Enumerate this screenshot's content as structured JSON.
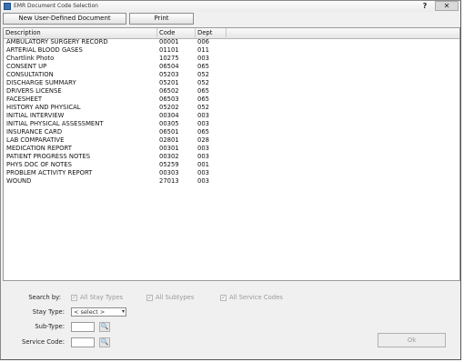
{
  "window": {
    "title": "EMR Document Code Selection",
    "help_glyph": "?",
    "close_glyph": "✕"
  },
  "toolbar": {
    "new_doc_label": "New User-Defined Document",
    "print_label": "Print"
  },
  "table": {
    "columns": [
      "Description",
      "Code",
      "Dept"
    ],
    "rows": [
      [
        "AMBULATORY SURGERY RECORD",
        "00001",
        "006"
      ],
      [
        "ARTERIAL BLOOD GASES",
        "01101",
        "011"
      ],
      [
        "Chartlink Photo",
        "10275",
        "003"
      ],
      [
        "CONSENT UP",
        "06504",
        "065"
      ],
      [
        "CONSULTATION",
        "05203",
        "052"
      ],
      [
        "DISCHARGE SUMMARY",
        "05201",
        "052"
      ],
      [
        "DRIVERS LICENSE",
        "06502",
        "065"
      ],
      [
        "FACESHEET",
        "06503",
        "065"
      ],
      [
        "HISTORY AND PHYSICAL",
        "05202",
        "052"
      ],
      [
        "INITIAL INTERVIEW",
        "00304",
        "003"
      ],
      [
        "INITIAL PHYSICAL ASSESSMENT",
        "00305",
        "003"
      ],
      [
        "INSURANCE CARD",
        "06501",
        "065"
      ],
      [
        "LAB COMPARATIVE",
        "02801",
        "028"
      ],
      [
        "MEDICATION REPORT",
        "00301",
        "003"
      ],
      [
        "PATIENT PROGRESS NOTES",
        "00302",
        "003"
      ],
      [
        "PHYS DOC OF NOTES",
        "05259",
        "001"
      ],
      [
        "PROBLEM ACTIVITY REPORT",
        "00303",
        "003"
      ],
      [
        "WOUND",
        "27013",
        "003"
      ]
    ]
  },
  "filters": {
    "search_by_label": "Search by:",
    "all_stay_types": "All Stay Types",
    "all_subtypes": "All Subtypes",
    "all_service_codes": "All Service Codes",
    "check_glyph": "✓",
    "stay_type_label": "Stay Type:",
    "stay_type_value": "< select >",
    "sub_type_label": "Sub-Type:",
    "service_code_label": "Service Code:",
    "lookup_glyph": "🔍"
  },
  "ok_label": "Ok"
}
